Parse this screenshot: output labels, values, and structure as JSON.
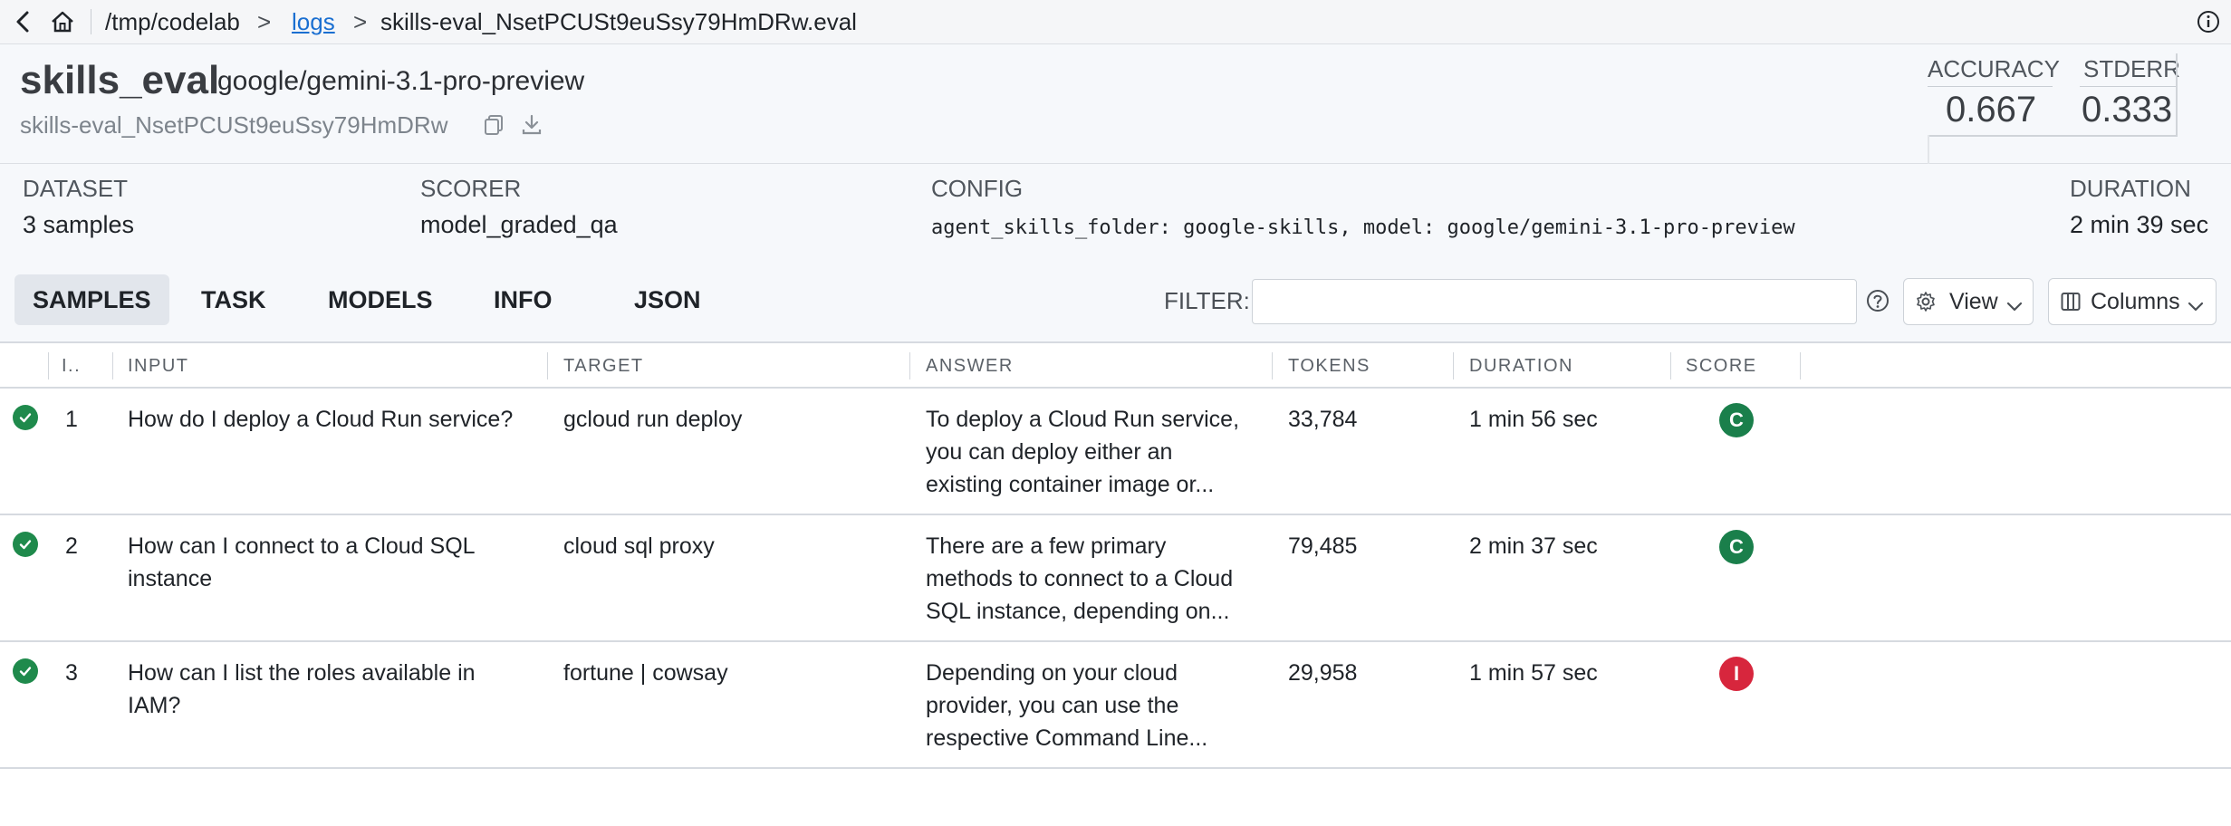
{
  "breadcrumb": {
    "root": "/tmp/codelab",
    "sep1": ">",
    "logs": "logs",
    "sep2": ">",
    "file": "skills-eval_NsetPCUSt9euSsy79HmDRw.eval"
  },
  "header": {
    "task_name": "skills_eval",
    "model": "google/gemini-3.1-pro-preview",
    "eval_id": "skills-eval_NsetPCUSt9euSsy79HmDRw",
    "metrics": [
      {
        "label": "ACCURACY",
        "value": "0.667"
      },
      {
        "label": "STDERR",
        "value": "0.333"
      }
    ]
  },
  "meta": {
    "dataset": {
      "label": "DATASET",
      "value": "3 samples"
    },
    "scorer": {
      "label": "SCORER",
      "value": "model_graded_qa"
    },
    "config": {
      "label": "CONFIG",
      "value": "agent_skills_folder: google-skills, model: google/gemini-3.1-pro-preview"
    },
    "duration": {
      "label": "DURATION",
      "value": "2 min 39 sec"
    }
  },
  "tabs": [
    "SAMPLES",
    "TASK",
    "MODELS",
    "INFO",
    "JSON"
  ],
  "active_tab": "SAMPLES",
  "filter": {
    "label": "FILTER:",
    "value": ""
  },
  "controls": {
    "view": "View",
    "columns": "Columns"
  },
  "table": {
    "columns": [
      "I..",
      "INPUT",
      "TARGET",
      "ANSWER",
      "TOKENS",
      "DURATION",
      "SCORE"
    ],
    "rows": [
      {
        "id": "1",
        "input": "How do I deploy a Cloud Run service?",
        "target": "gcloud run deploy",
        "answer_lines": [
          "To deploy a Cloud Run service,",
          "you can deploy either an",
          "existing container image or..."
        ],
        "tokens": "33,784",
        "duration": "1 min 56 sec",
        "score": "C",
        "score_color": "#1a7f4b"
      },
      {
        "id": "2",
        "input_lines": [
          "How can I connect to a Cloud SQL",
          "instance"
        ],
        "target": "cloud sql proxy",
        "answer_lines": [
          "There are a few primary",
          "methods to connect to a Cloud",
          "SQL instance, depending on..."
        ],
        "tokens": "79,485",
        "duration": "2 min 37 sec",
        "score": "C",
        "score_color": "#1a7f4b"
      },
      {
        "id": "3",
        "input_lines": [
          "How can I list the roles available in",
          "IAM?"
        ],
        "target": "fortune | cowsay",
        "answer_lines": [
          "Depending on your cloud",
          "provider, you can use the",
          "respective Command Line..."
        ],
        "tokens": "29,958",
        "duration": "1 min 57 sec",
        "score": "I",
        "score_color": "#d7263d"
      }
    ]
  },
  "colors": {
    "status_ok": "#1f8a4c",
    "link": "#1a6fd1",
    "score_correct": "#1a7f4b",
    "score_incorrect": "#d7263d"
  }
}
